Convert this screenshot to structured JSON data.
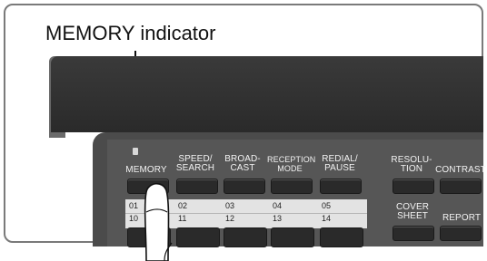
{
  "callout": {
    "label": "MEMORY indicator"
  },
  "panel": {
    "top_labels": [
      {
        "text": "MEMORY",
        "class": "normal"
      },
      {
        "text": "SPEED/\nSEARCH",
        "class": "normal"
      },
      {
        "text": "BROAD-\nCAST",
        "class": "normal"
      },
      {
        "text": "RECEPTION\nMODE",
        "class": "small"
      },
      {
        "text": "REDIAL/\nPAUSE",
        "class": "normal"
      }
    ],
    "right_labels": [
      {
        "text": "RESOLU-\nTION",
        "class": "normal"
      },
      {
        "text": "CONTRAST",
        "class": "normal"
      },
      {
        "text": "COVER\nSHEET",
        "class": "normal"
      },
      {
        "text": "REPORT",
        "class": "normal"
      }
    ],
    "speed_dial": {
      "row1": [
        "01",
        "02",
        "03",
        "04",
        "05"
      ],
      "row2": [
        "10",
        "11",
        "12",
        "13",
        "14"
      ]
    }
  },
  "colors": {
    "panel": "#565656",
    "device": "#3a3a3a",
    "button": "#2a2a2a",
    "strip": "#e3e3e3"
  }
}
